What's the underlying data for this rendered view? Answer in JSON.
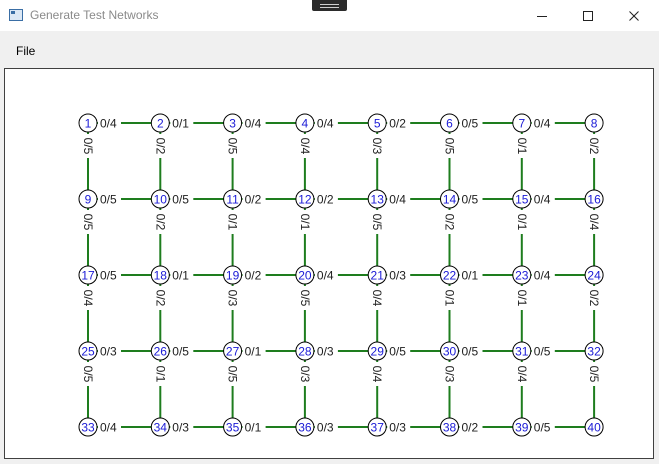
{
  "window": {
    "title": "Generate Test Networks",
    "controls": {
      "minimize": "minimize-icon",
      "maximize": "maximize-icon",
      "close": "close-icon"
    }
  },
  "menu": {
    "items": [
      {
        "label": "File"
      }
    ]
  },
  "network": {
    "rows": 5,
    "cols": 8,
    "node_color": "#1a1ad6",
    "edge_color": "#1e7d1e",
    "nodes": [
      1,
      2,
      3,
      4,
      5,
      6,
      7,
      8,
      9,
      10,
      11,
      12,
      13,
      14,
      15,
      16,
      17,
      18,
      19,
      20,
      21,
      22,
      23,
      24,
      25,
      26,
      27,
      28,
      29,
      30,
      31,
      32,
      33,
      34,
      35,
      36,
      37,
      38,
      39,
      40
    ],
    "horizontal_edges": [
      [
        "0/4",
        "0/1",
        "0/4",
        "0/4",
        "0/2",
        "0/5",
        "0/4"
      ],
      [
        "0/5",
        "0/5",
        "0/2",
        "0/2",
        "0/4",
        "0/5",
        "0/4"
      ],
      [
        "0/5",
        "0/1",
        "0/2",
        "0/4",
        "0/3",
        "0/1",
        "0/4"
      ],
      [
        "0/3",
        "0/5",
        "0/1",
        "0/3",
        "0/5",
        "0/5",
        "0/5"
      ],
      [
        "0/4",
        "0/3",
        "0/1",
        "0/3",
        "0/3",
        "0/2",
        "0/5"
      ]
    ],
    "vertical_edges": [
      [
        "0/5",
        "0/2",
        "0/5",
        "0/4",
        "0/3",
        "0/5",
        "0/1",
        "0/2"
      ],
      [
        "0/5",
        "0/2",
        "0/1",
        "0/1",
        "0/5",
        "0/2",
        "0/1",
        "0/4"
      ],
      [
        "0/4",
        "0/2",
        "0/3",
        "0/5",
        "0/4",
        "0/1",
        "0/1",
        "0/2"
      ],
      [
        "0/5",
        "0/1",
        "0/5",
        "0/3",
        "0/4",
        "0/3",
        "0/4",
        "0/5"
      ]
    ]
  }
}
